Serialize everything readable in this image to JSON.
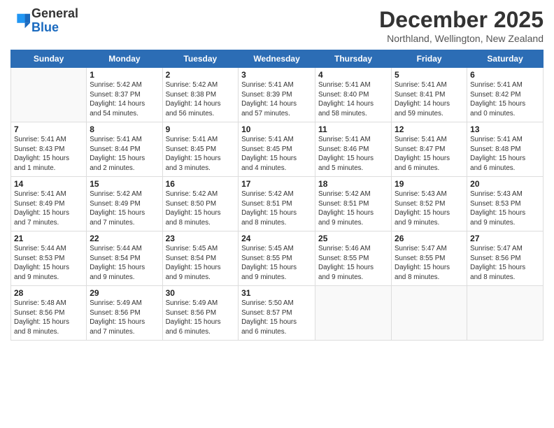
{
  "logo": {
    "general": "General",
    "blue": "Blue"
  },
  "title": "December 2025",
  "subtitle": "Northland, Wellington, New Zealand",
  "days_header": [
    "Sunday",
    "Monday",
    "Tuesday",
    "Wednesday",
    "Thursday",
    "Friday",
    "Saturday"
  ],
  "weeks": [
    [
      {
        "day": "",
        "info": ""
      },
      {
        "day": "1",
        "info": "Sunrise: 5:42 AM\nSunset: 8:37 PM\nDaylight: 14 hours\nand 54 minutes."
      },
      {
        "day": "2",
        "info": "Sunrise: 5:42 AM\nSunset: 8:38 PM\nDaylight: 14 hours\nand 56 minutes."
      },
      {
        "day": "3",
        "info": "Sunrise: 5:41 AM\nSunset: 8:39 PM\nDaylight: 14 hours\nand 57 minutes."
      },
      {
        "day": "4",
        "info": "Sunrise: 5:41 AM\nSunset: 8:40 PM\nDaylight: 14 hours\nand 58 minutes."
      },
      {
        "day": "5",
        "info": "Sunrise: 5:41 AM\nSunset: 8:41 PM\nDaylight: 14 hours\nand 59 minutes."
      },
      {
        "day": "6",
        "info": "Sunrise: 5:41 AM\nSunset: 8:42 PM\nDaylight: 15 hours\nand 0 minutes."
      }
    ],
    [
      {
        "day": "7",
        "info": "Sunrise: 5:41 AM\nSunset: 8:43 PM\nDaylight: 15 hours\nand 1 minute."
      },
      {
        "day": "8",
        "info": "Sunrise: 5:41 AM\nSunset: 8:44 PM\nDaylight: 15 hours\nand 2 minutes."
      },
      {
        "day": "9",
        "info": "Sunrise: 5:41 AM\nSunset: 8:45 PM\nDaylight: 15 hours\nand 3 minutes."
      },
      {
        "day": "10",
        "info": "Sunrise: 5:41 AM\nSunset: 8:45 PM\nDaylight: 15 hours\nand 4 minutes."
      },
      {
        "day": "11",
        "info": "Sunrise: 5:41 AM\nSunset: 8:46 PM\nDaylight: 15 hours\nand 5 minutes."
      },
      {
        "day": "12",
        "info": "Sunrise: 5:41 AM\nSunset: 8:47 PM\nDaylight: 15 hours\nand 6 minutes."
      },
      {
        "day": "13",
        "info": "Sunrise: 5:41 AM\nSunset: 8:48 PM\nDaylight: 15 hours\nand 6 minutes."
      }
    ],
    [
      {
        "day": "14",
        "info": "Sunrise: 5:41 AM\nSunset: 8:49 PM\nDaylight: 15 hours\nand 7 minutes."
      },
      {
        "day": "15",
        "info": "Sunrise: 5:42 AM\nSunset: 8:49 PM\nDaylight: 15 hours\nand 7 minutes."
      },
      {
        "day": "16",
        "info": "Sunrise: 5:42 AM\nSunset: 8:50 PM\nDaylight: 15 hours\nand 8 minutes."
      },
      {
        "day": "17",
        "info": "Sunrise: 5:42 AM\nSunset: 8:51 PM\nDaylight: 15 hours\nand 8 minutes."
      },
      {
        "day": "18",
        "info": "Sunrise: 5:42 AM\nSunset: 8:51 PM\nDaylight: 15 hours\nand 9 minutes."
      },
      {
        "day": "19",
        "info": "Sunrise: 5:43 AM\nSunset: 8:52 PM\nDaylight: 15 hours\nand 9 minutes."
      },
      {
        "day": "20",
        "info": "Sunrise: 5:43 AM\nSunset: 8:53 PM\nDaylight: 15 hours\nand 9 minutes."
      }
    ],
    [
      {
        "day": "21",
        "info": "Sunrise: 5:44 AM\nSunset: 8:53 PM\nDaylight: 15 hours\nand 9 minutes."
      },
      {
        "day": "22",
        "info": "Sunrise: 5:44 AM\nSunset: 8:54 PM\nDaylight: 15 hours\nand 9 minutes."
      },
      {
        "day": "23",
        "info": "Sunrise: 5:45 AM\nSunset: 8:54 PM\nDaylight: 15 hours\nand 9 minutes."
      },
      {
        "day": "24",
        "info": "Sunrise: 5:45 AM\nSunset: 8:55 PM\nDaylight: 15 hours\nand 9 minutes."
      },
      {
        "day": "25",
        "info": "Sunrise: 5:46 AM\nSunset: 8:55 PM\nDaylight: 15 hours\nand 9 minutes."
      },
      {
        "day": "26",
        "info": "Sunrise: 5:47 AM\nSunset: 8:55 PM\nDaylight: 15 hours\nand 8 minutes."
      },
      {
        "day": "27",
        "info": "Sunrise: 5:47 AM\nSunset: 8:56 PM\nDaylight: 15 hours\nand 8 minutes."
      }
    ],
    [
      {
        "day": "28",
        "info": "Sunrise: 5:48 AM\nSunset: 8:56 PM\nDaylight: 15 hours\nand 8 minutes."
      },
      {
        "day": "29",
        "info": "Sunrise: 5:49 AM\nSunset: 8:56 PM\nDaylight: 15 hours\nand 7 minutes."
      },
      {
        "day": "30",
        "info": "Sunrise: 5:49 AM\nSunset: 8:56 PM\nDaylight: 15 hours\nand 6 minutes."
      },
      {
        "day": "31",
        "info": "Sunrise: 5:50 AM\nSunset: 8:57 PM\nDaylight: 15 hours\nand 6 minutes."
      },
      {
        "day": "",
        "info": ""
      },
      {
        "day": "",
        "info": ""
      },
      {
        "day": "",
        "info": ""
      }
    ]
  ]
}
